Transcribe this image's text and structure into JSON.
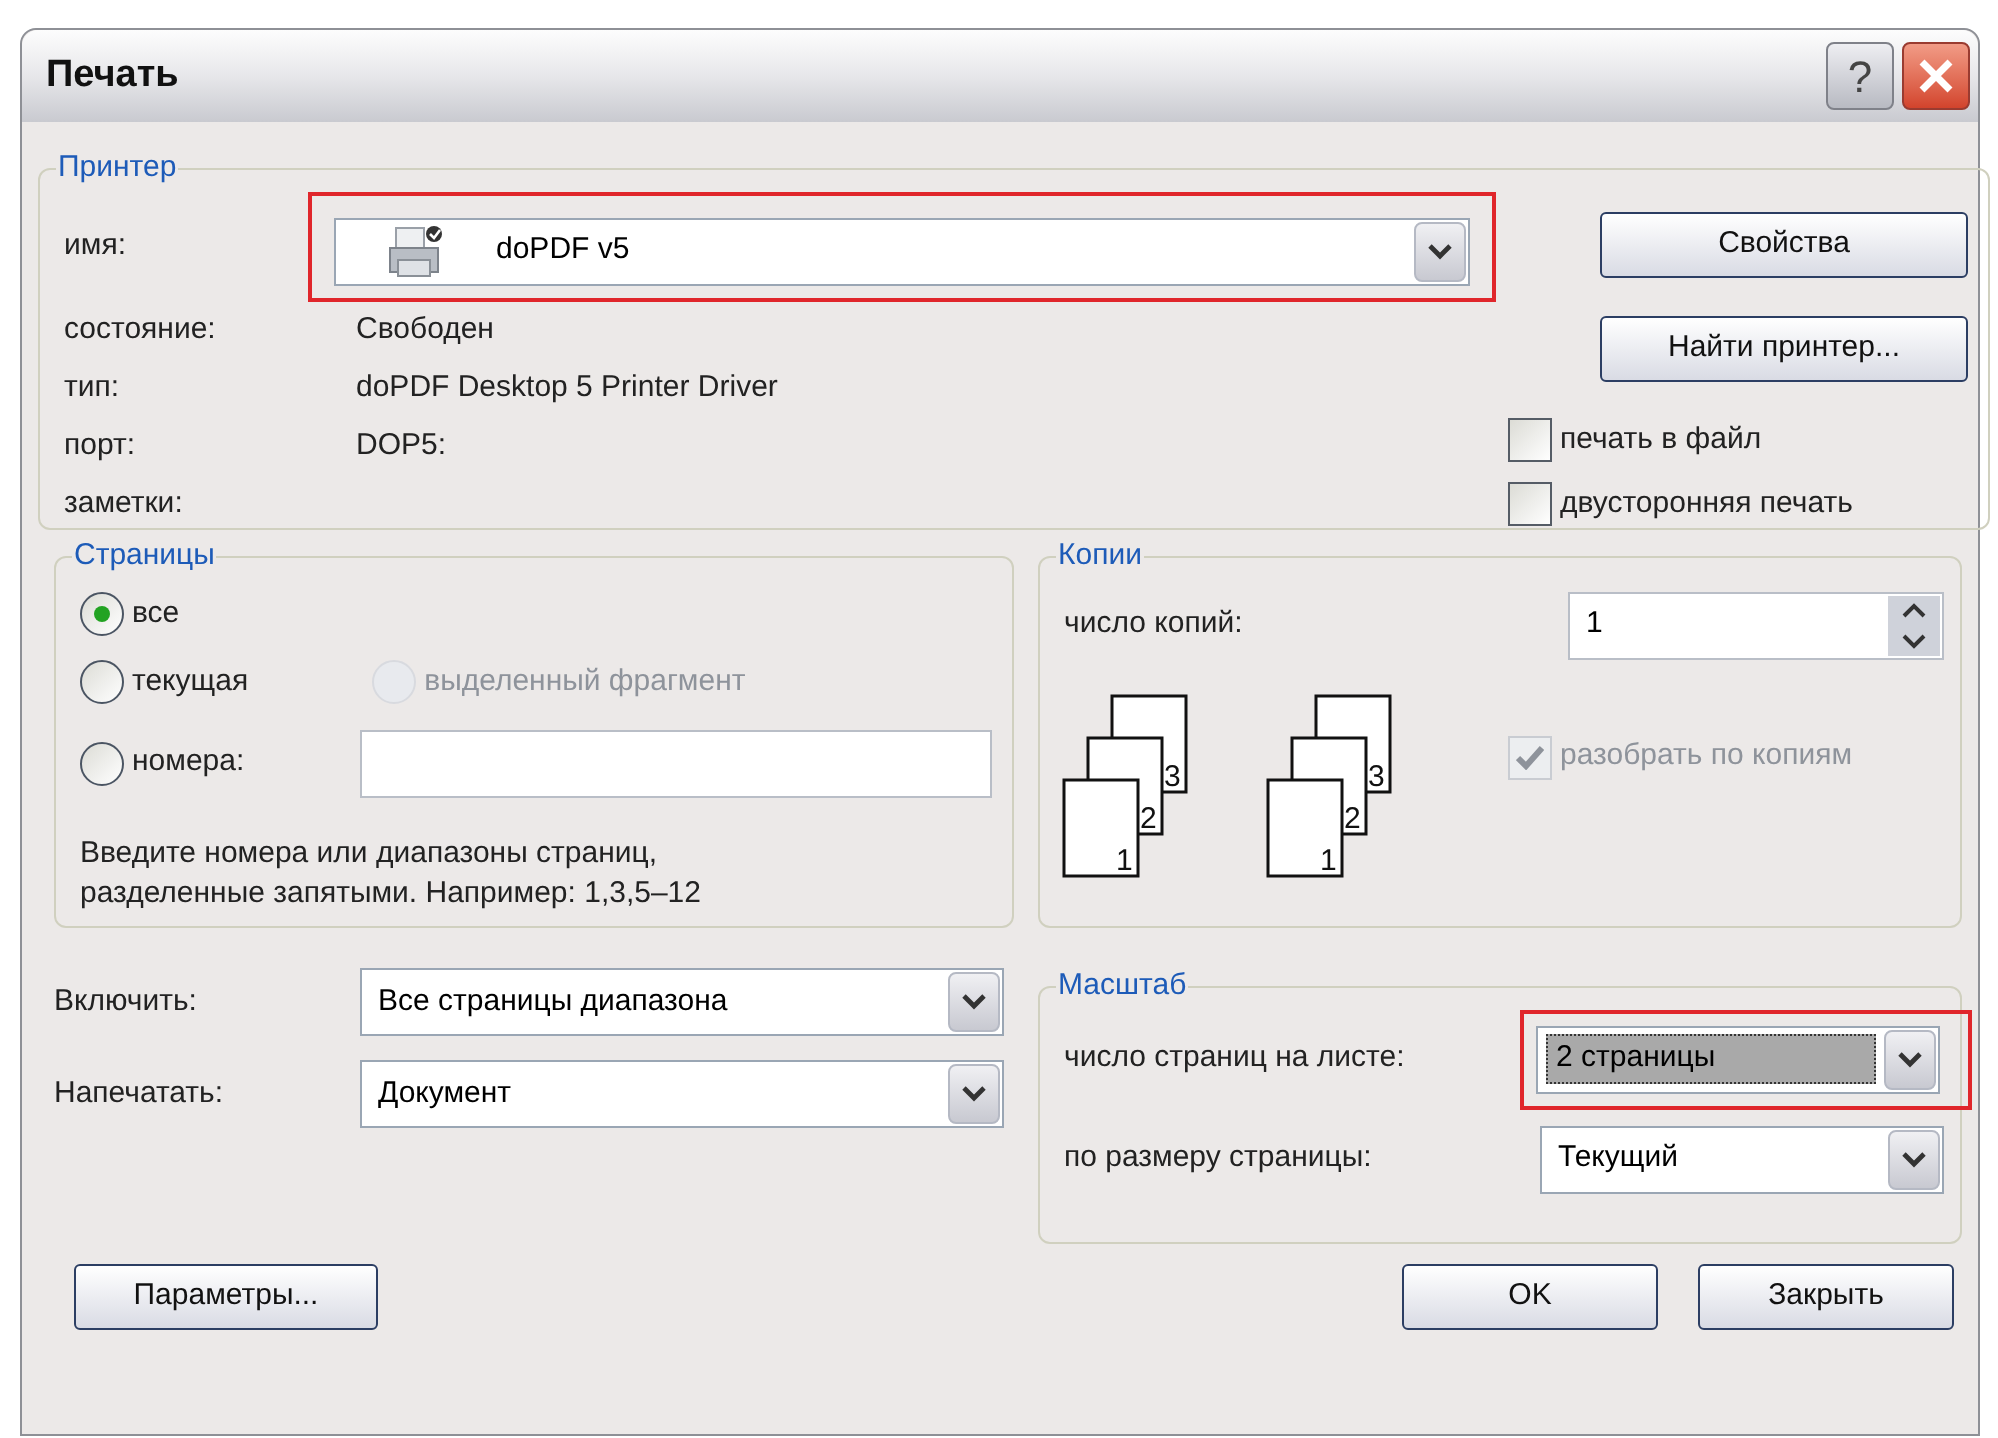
{
  "window": {
    "title": "Печать",
    "help_label": "?"
  },
  "printer": {
    "legend": "Принтер",
    "name_label": "имя:",
    "name": "doPDF v5",
    "highlighted": true,
    "fields": [
      {
        "label": "состояние:",
        "value": "Свободен"
      },
      {
        "label": "тип:",
        "value": "doPDF Desktop 5 Printer Driver"
      },
      {
        "label": "порт:",
        "value": "DOP5:"
      },
      {
        "label": "заметки:"
      }
    ],
    "buttons": [
      "Свойства",
      "Найти принтер..."
    ],
    "options": [
      {
        "label": "печать в файл",
        "checked": false
      },
      {
        "label": "двусторонняя печать",
        "checked": false
      }
    ]
  },
  "pages": {
    "legend": "Страницы",
    "options": [
      {
        "label": "все",
        "selected": true,
        "disabled": false
      },
      {
        "label": "текущая",
        "selected": false,
        "disabled": false
      },
      {
        "label": "выделенный фрагмент",
        "selected": false,
        "disabled": true
      },
      {
        "label": "номера:",
        "selected": false,
        "disabled": false
      }
    ],
    "hint": "Введите номера или диапазоны страниц,\nразделенные запятыми. Например: 1,3,5–12"
  },
  "include": [
    {
      "label": "Включить:",
      "value": "Все страницы диапазона"
    },
    {
      "label": "Напечатать:",
      "value": "Документ"
    }
  ],
  "copies": {
    "legend": "Копии",
    "label": "число копий:",
    "value": "1",
    "stacks": [
      [
        "1",
        "2",
        "3"
      ],
      [
        "1",
        "2",
        "3"
      ]
    ],
    "collate": {
      "label": "разобрать по копиям",
      "checked": true,
      "disabled": true
    }
  },
  "scale": {
    "legend": "Масштаб",
    "rows": [
      {
        "label": "число страниц на листе:",
        "value": "2 страницы",
        "highlighted": true,
        "focused": true
      },
      {
        "label": "по размеру страницы:",
        "value": "Текущий",
        "highlighted": false,
        "focused": false
      }
    ]
  },
  "footer": {
    "options_button": "Параметры...",
    "ok": "OK",
    "close": "Закрыть"
  }
}
